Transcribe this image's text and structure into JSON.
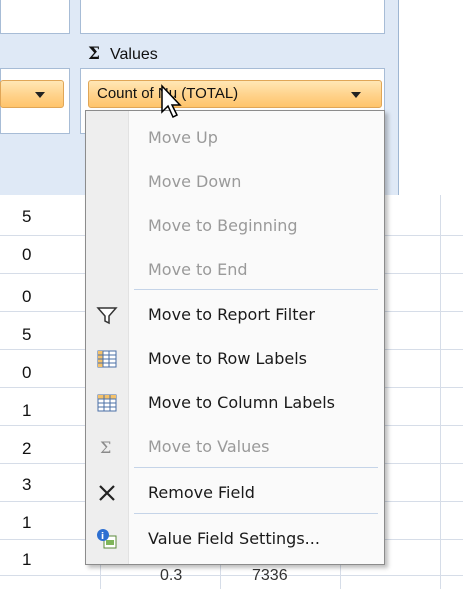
{
  "values_area": {
    "sigma": "Σ",
    "label": "Values",
    "field_button": "Count of Nu (TOTAL)"
  },
  "context_menu": {
    "items": [
      {
        "label": "Move Up",
        "accel": "U",
        "enabled": false,
        "icon": null
      },
      {
        "label": "Move Down",
        "accel": "D",
        "enabled": false,
        "icon": null
      },
      {
        "label": "Move to Beginning",
        "accel": "g",
        "enabled": false,
        "icon": null
      },
      {
        "label": "Move to End",
        "accel": "E",
        "enabled": false,
        "icon": null
      },
      {
        "label": "Move to Report Filter",
        "enabled": true,
        "icon": "filter-icon"
      },
      {
        "label": "Move to Row Labels",
        "enabled": true,
        "icon": "row-labels-icon"
      },
      {
        "label": "Move to Column Labels",
        "enabled": true,
        "icon": "column-labels-icon"
      },
      {
        "label": "Move to Values",
        "enabled": false,
        "icon": "sigma-icon"
      },
      {
        "label": "Remove Field",
        "enabled": true,
        "icon": "remove-x-icon"
      },
      {
        "label": "Value Field Settings...",
        "accel": "n",
        "enabled": true,
        "icon": "value-field-settings-icon"
      }
    ]
  },
  "sheet": {
    "column_a_values": [
      "5",
      "0",
      "0",
      "5",
      "0",
      "1",
      "2",
      "3",
      "1",
      "1"
    ],
    "partial_bottom_text": [
      "0.3",
      "7336"
    ]
  },
  "colors": {
    "panel_background": "#dfe9f6",
    "field_button_fill": "#ffd28a",
    "field_button_border": "#e0a657",
    "menu_background": "#fafafa",
    "disabled_text": "#9a9a9a"
  }
}
